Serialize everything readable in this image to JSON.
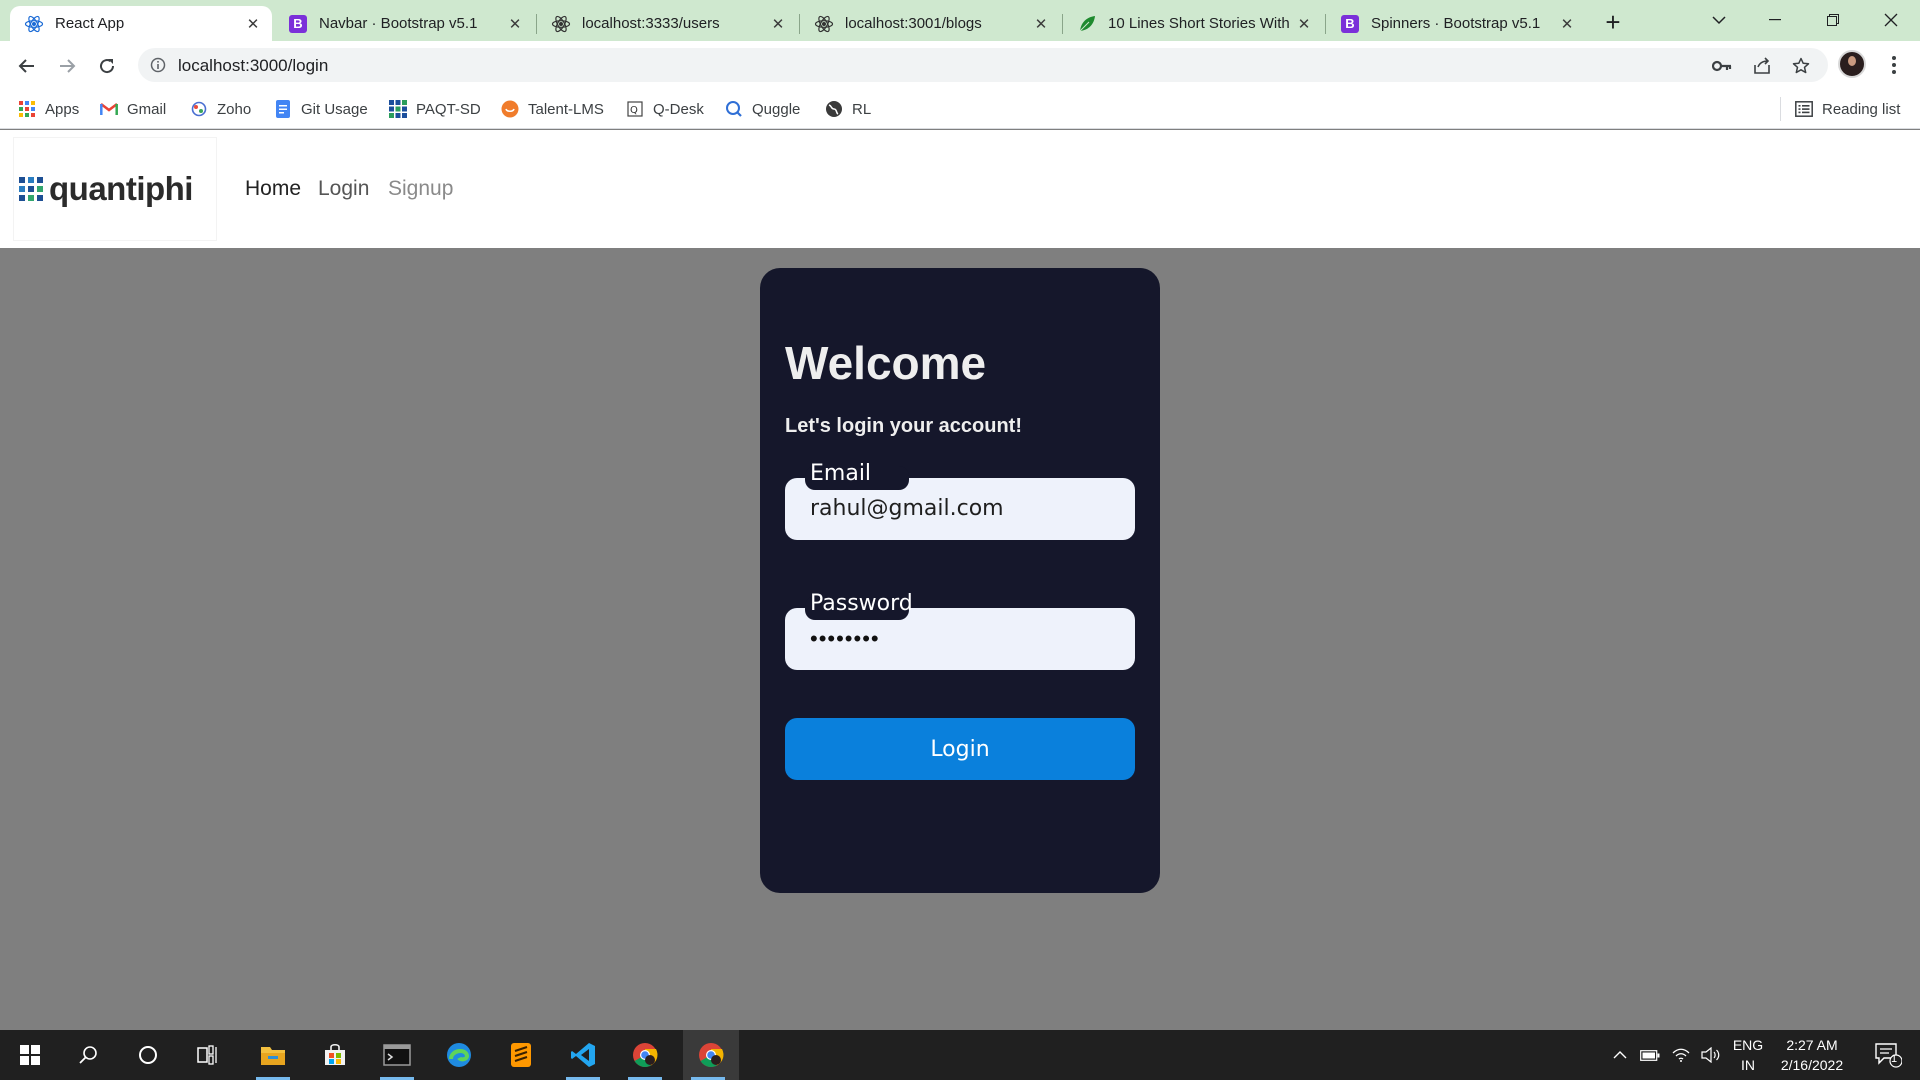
{
  "browser": {
    "tabs": [
      {
        "title": "React App",
        "icon": "react-icon",
        "active": true
      },
      {
        "title": "Navbar · Bootstrap v5.1",
        "icon": "bootstrap-icon",
        "active": false
      },
      {
        "title": "localhost:3333/users",
        "icon": "react-icon",
        "active": false
      },
      {
        "title": "localhost:3001/blogs",
        "icon": "react-icon",
        "active": false
      },
      {
        "title": "10 Lines Short Stories With",
        "icon": "leaf-icon",
        "active": false
      },
      {
        "title": "Spinners · Bootstrap v5.1",
        "icon": "bootstrap-icon",
        "active": false
      }
    ],
    "url": "localhost:3000/login",
    "bookmarks": [
      {
        "label": "Apps",
        "icon": "apps-grid-icon"
      },
      {
        "label": "Gmail",
        "icon": "gmail-icon"
      },
      {
        "label": "Zoho",
        "icon": "zoho-icon"
      },
      {
        "label": "Git Usage",
        "icon": "docs-icon"
      },
      {
        "label": "PAQT-SD",
        "icon": "grid-icon"
      },
      {
        "label": "Talent-LMS",
        "icon": "talentlms-icon"
      },
      {
        "label": "Q-Desk",
        "icon": "qdesk-icon"
      },
      {
        "label": "Quggle",
        "icon": "quggle-icon"
      },
      {
        "label": "RL",
        "icon": "globe-icon"
      }
    ],
    "reading_list": "Reading list"
  },
  "navbar": {
    "brand": "quantiphi",
    "links": {
      "home": "Home",
      "login": "Login",
      "signup": "Signup"
    }
  },
  "login_card": {
    "title": "Welcome",
    "subtitle": "Let's login your account!",
    "email_label": "Email",
    "email_value": "rahul@gmail.com",
    "password_label": "Password",
    "password_value": "••••••••",
    "button": "Login"
  },
  "taskbar": {
    "apps": [
      "start-icon",
      "search-icon",
      "cortana-icon",
      "task-view-icon",
      "file-explorer-icon",
      "store-icon",
      "terminal-icon",
      "edge-icon",
      "sublime-icon",
      "vscode-icon",
      "chrome-icon",
      "chrome-profile-icon"
    ],
    "language": "ENG",
    "region": "IN",
    "time": "2:27 AM",
    "date": "2/16/2022",
    "notification_count": "1"
  },
  "colors": {
    "tab_strip": "#cfe8cf",
    "card_bg": "#15172b",
    "page_bg": "#7f7f7f",
    "button": "#0a80dc",
    "input_bg": "#eef2fb"
  }
}
